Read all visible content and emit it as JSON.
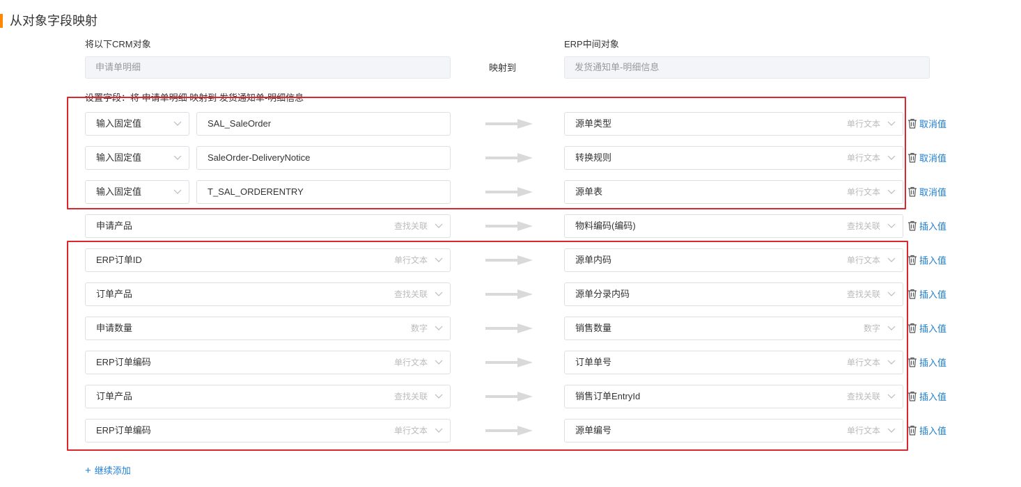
{
  "section_title": "从对象字段映射",
  "crm_label": "将以下CRM对象",
  "erp_label": "ERP中间对象",
  "crm_object": "申请单明细",
  "erp_object": "发货通知单-明细信息",
  "map_to_label": "映射到",
  "set_fields_text": "设置字段：将 申请单明细 映射到 发货通知单-明细信息",
  "fixed_rows": [
    {
      "source_mode": "输入固定值",
      "fixed_value": "SAL_SaleOrder",
      "target": "源单类型",
      "target_type": "单行文本",
      "action": "取消值"
    },
    {
      "source_mode": "输入固定值",
      "fixed_value": "SaleOrder-DeliveryNotice",
      "target": "转换规则",
      "target_type": "单行文本",
      "action": "取消值"
    },
    {
      "source_mode": "输入固定值",
      "fixed_value": "T_SAL_ORDERENTRY",
      "target": "源单表",
      "target_type": "单行文本",
      "action": "取消值"
    }
  ],
  "field_rows": [
    {
      "source": "申请产品",
      "source_type": "查找关联",
      "target": "物料编码(编码)",
      "target_type": "查找关联",
      "action": "插入值"
    },
    {
      "source": "ERP订单ID",
      "source_type": "单行文本",
      "target": "源单内码",
      "target_type": "单行文本",
      "action": "插入值"
    },
    {
      "source": "订单产品",
      "source_type": "查找关联",
      "target": "源单分录内码",
      "target_type": "查找关联",
      "action": "插入值"
    },
    {
      "source": "申请数量",
      "source_type": "数字",
      "target": "销售数量",
      "target_type": "数字",
      "action": "插入值"
    },
    {
      "source": "ERP订单编码",
      "source_type": "单行文本",
      "target": "订单单号",
      "target_type": "单行文本",
      "action": "插入值"
    },
    {
      "source": "订单产品",
      "source_type": "查找关联",
      "target": "销售订单EntryId",
      "target_type": "查找关联",
      "action": "插入值"
    },
    {
      "source": "ERP订单编码",
      "source_type": "单行文本",
      "target": "源单编号",
      "target_type": "单行文本",
      "action": "插入值"
    }
  ],
  "add_more_label": "继续添加",
  "colors": {
    "accent": "#ff8800",
    "link": "#1e7fd6",
    "highlight": "#e0242b",
    "arrow": "#d9d9d9"
  }
}
